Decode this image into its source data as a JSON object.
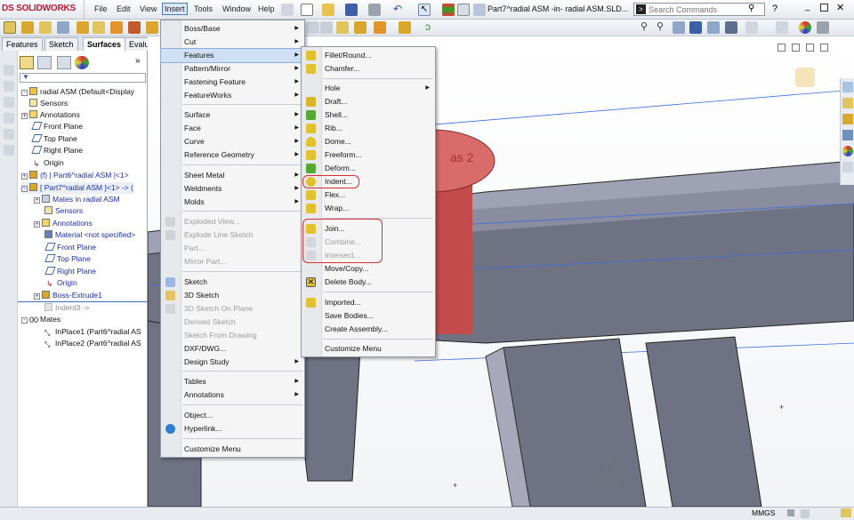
{
  "app": {
    "logo": "SOLIDWORKS",
    "logo_prefix": "DS"
  },
  "menubar": {
    "items": [
      "File",
      "Edit",
      "View",
      "Insert",
      "Tools",
      "Window",
      "Help"
    ]
  },
  "document_title": "Part7^radial ASM -in- radial ASM.SLD...",
  "search": {
    "placeholder": "Search Commands"
  },
  "tabs": [
    "Features",
    "Sketch",
    "Surfaces",
    "Evaluat"
  ],
  "feature_tree": {
    "items": [
      {
        "label": "radial ASM  (Default<Display",
        "style": "normal"
      },
      {
        "label": "Sensors",
        "style": "normal"
      },
      {
        "label": "Annotations",
        "style": "normal"
      },
      {
        "label": "Front Plane",
        "style": "normal"
      },
      {
        "label": "Top Plane",
        "style": "normal"
      },
      {
        "label": "Right Plane",
        "style": "normal"
      },
      {
        "label": "Origin",
        "style": "normal"
      },
      {
        "label": "(f) | Part6^radial ASM |<1>",
        "style": "blue"
      },
      {
        "label": "[ Part7^radial ASM ]<1> -> (",
        "style": "blue"
      },
      {
        "label": "Mates in radial ASM",
        "style": "blue"
      },
      {
        "label": "Sensors",
        "style": "blue"
      },
      {
        "label": "Annotations",
        "style": "blue"
      },
      {
        "label": "Material <not specified>",
        "style": "blue"
      },
      {
        "label": "Front Plane",
        "style": "blue"
      },
      {
        "label": "Top Plane",
        "style": "blue"
      },
      {
        "label": "Right Plane",
        "style": "blue"
      },
      {
        "label": "Origin",
        "style": "blue"
      },
      {
        "label": "Boss-Extrude1",
        "style": "blue"
      },
      {
        "label": "Indent3 ->",
        "style": "gray"
      },
      {
        "label": "Mates",
        "style": "normal"
      },
      {
        "label": "InPlace1 (Part6^radial AS",
        "style": "normal"
      },
      {
        "label": "InPlace2 (Part6^radial AS",
        "style": "normal"
      }
    ]
  },
  "insert_menu": {
    "items": [
      {
        "label": "Boss/Base",
        "submenu": true
      },
      {
        "label": "Cut",
        "submenu": true
      },
      {
        "label": "Features",
        "submenu": true,
        "highlighted": true
      },
      {
        "label": "Pattern/Mirror",
        "submenu": true
      },
      {
        "label": "Fastening Feature",
        "submenu": true
      },
      {
        "label": "FeatureWorks",
        "submenu": true
      },
      {
        "label": "Surface",
        "submenu": true
      },
      {
        "label": "Face",
        "submenu": true
      },
      {
        "label": "Curve",
        "submenu": true
      },
      {
        "label": "Reference Geometry",
        "submenu": true
      },
      {
        "label": "Sheet Metal",
        "submenu": true
      },
      {
        "label": "Weldments",
        "submenu": true
      },
      {
        "label": "Molds",
        "submenu": true
      },
      {
        "label": "Exploded View...",
        "disabled": true
      },
      {
        "label": "Explode Line Sketch",
        "disabled": true
      },
      {
        "label": "Part...",
        "disabled": true
      },
      {
        "label": "Mirror Part...",
        "disabled": true
      },
      {
        "label": "Sketch"
      },
      {
        "label": "3D Sketch"
      },
      {
        "label": "3D Sketch On Plane",
        "disabled": true
      },
      {
        "label": "Derived Sketch",
        "disabled": true
      },
      {
        "label": "Sketch From Drawing",
        "disabled": true
      },
      {
        "label": "DXF/DWG..."
      },
      {
        "label": "Design Study",
        "submenu": true
      },
      {
        "label": "Tables",
        "submenu": true
      },
      {
        "label": "Annotations",
        "submenu": true
      },
      {
        "label": "Object..."
      },
      {
        "label": "Hyperlink..."
      },
      {
        "label": "Customize Menu"
      }
    ]
  },
  "features_menu": {
    "items": [
      {
        "label": "Fillet/Round..."
      },
      {
        "label": "Chamfer..."
      },
      {
        "label": "Hole",
        "submenu": true
      },
      {
        "label": "Draft..."
      },
      {
        "label": "Shell..."
      },
      {
        "label": "Rib..."
      },
      {
        "label": "Dome..."
      },
      {
        "label": "Freeform..."
      },
      {
        "label": "Deform..."
      },
      {
        "label": "Indent..."
      },
      {
        "label": "Flex..."
      },
      {
        "label": "Wrap..."
      },
      {
        "label": "Join..."
      },
      {
        "label": "Combine...",
        "disabled": true
      },
      {
        "label": "Intersect...",
        "disabled": true
      },
      {
        "label": "Move/Copy..."
      },
      {
        "label": "Delete Body..."
      },
      {
        "label": "Imported..."
      },
      {
        "label": "Save Bodies..."
      },
      {
        "label": "Create Assembly..."
      },
      {
        "label": "Customize Menu"
      }
    ]
  },
  "viewport": {
    "part_label": "as 2"
  },
  "status": {
    "units": "MMGS"
  },
  "colors": {
    "accent": "#c8102e",
    "highlight": "#cfe0f5",
    "part_red": "#d96b6b",
    "body": "#7d7f8c"
  }
}
